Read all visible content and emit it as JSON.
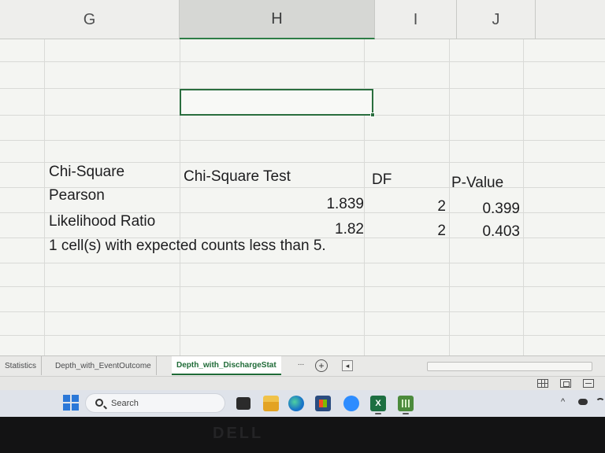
{
  "columns": [
    "G",
    "H",
    "I",
    "J"
  ],
  "table": {
    "header": {
      "label": "Chi-Square",
      "test": "Chi-Square Test",
      "df": "DF",
      "p": "P-Value"
    },
    "rows": [
      {
        "label": "Pearson",
        "stat": "1.839",
        "df": "2",
        "p": "0.399"
      },
      {
        "label": "Likelihood Ratio",
        "stat": "1.82",
        "df": "2",
        "p": "0.403"
      }
    ],
    "note": "1 cell(s) with expected counts less than 5."
  },
  "sheet_tabs": {
    "tabs": [
      "Statistics",
      "Depth_with_EventOutcome",
      "Depth_with_DischargeStat"
    ],
    "active": "Depth_with_DischargeStat",
    "more": "...",
    "add": "+",
    "scroll_left": "◂"
  },
  "taskbar": {
    "search_label": "Search",
    "excel_glyph": "X",
    "tray_chevron": "^"
  },
  "colors": {
    "excel_green": "#1d6f42",
    "selection_border": "#2a6e3e",
    "windows_blue": "#2b78d8"
  }
}
